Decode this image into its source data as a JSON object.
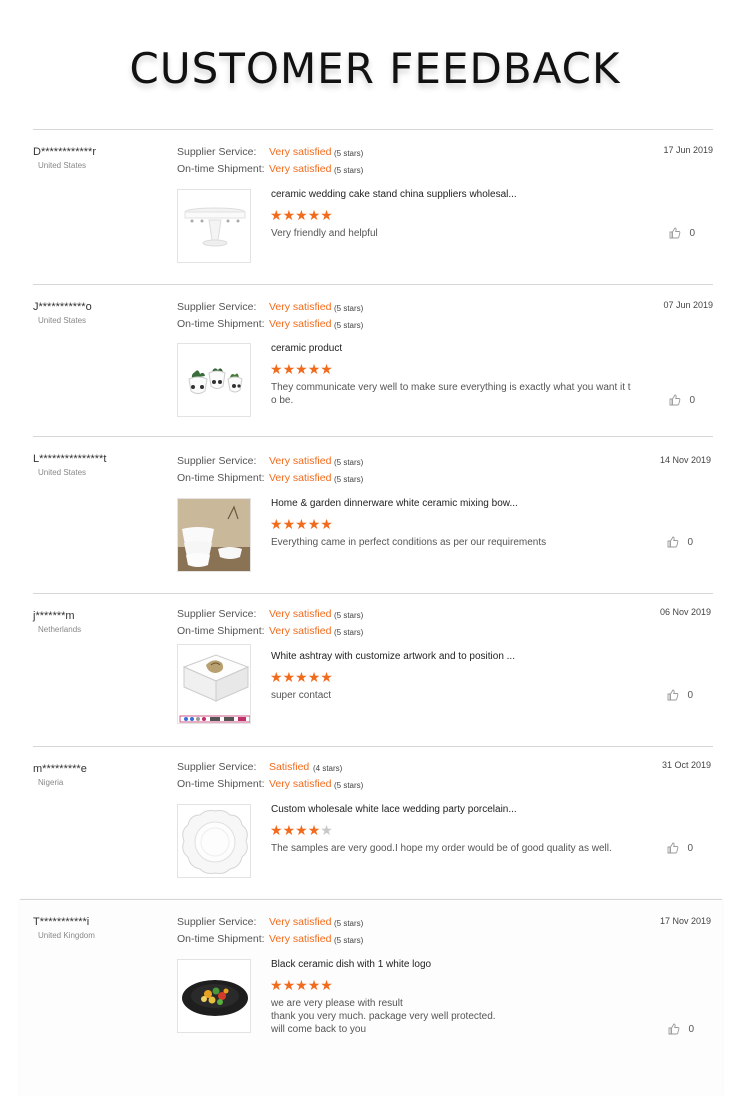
{
  "title": "CUSTOMER FEEDBACK",
  "labels": {
    "supplier_service": "Supplier Service:",
    "ontime_shipment": "On-time Shipment:"
  },
  "colors": {
    "accent": "#f26b1d",
    "star_off": "#c8c8c8"
  },
  "reviews": [
    {
      "user": "D************r",
      "country": "United States",
      "date": "17 Jun 2019",
      "supplier_value": "Very satisfied",
      "supplier_stars": "(5 stars)",
      "shipment_value": "Very satisfied",
      "shipment_stars": "(5 stars)",
      "product": "ceramic wedding cake stand china suppliers wholesal...",
      "rating": 5,
      "comment": "Very friendly and helpful",
      "likes": "0",
      "thumb_icon": "cake-stand-image"
    },
    {
      "user": "J***********o",
      "country": "United States",
      "date": "07 Jun 2019",
      "supplier_value": "Very satisfied",
      "supplier_stars": "(5 stars)",
      "shipment_value": "Very satisfied",
      "shipment_stars": "(5 stars)",
      "product": "ceramic product",
      "rating": 5,
      "comment": "They communicate very well to make sure everything is exactly what you want it t o be.",
      "likes": "0",
      "thumb_icon": "ceramic-pots-image"
    },
    {
      "user": "L***************t",
      "country": "United States",
      "date": "14 Nov 2019",
      "supplier_value": "Very satisfied",
      "supplier_stars": "(5 stars)",
      "shipment_value": "Very satisfied",
      "shipment_stars": "(5 stars)",
      "product": "Home & garden dinnerware white ceramic mixing bow...",
      "rating": 5,
      "comment": "Everything came in perfect conditions as per our requirements",
      "likes": "0",
      "thumb_icon": "mixing-bowls-image"
    },
    {
      "user": "j*******m",
      "country": "Netherlands",
      "date": "06 Nov 2019",
      "supplier_value": "Very satisfied",
      "supplier_stars": "(5 stars)",
      "shipment_value": "Very satisfied",
      "shipment_stars": "(5 stars)",
      "product": "White ashtray with customize artwork and to position ...",
      "rating": 5,
      "comment": "super contact",
      "likes": "0",
      "thumb_icon": "ashtray-image"
    },
    {
      "user": "m*********e",
      "country": "Nigeria",
      "date": "31 Oct 2019",
      "supplier_value": "Satisfied",
      "supplier_stars": "(4 stars)",
      "shipment_value": "Very satisfied",
      "shipment_stars": "(5 stars)",
      "product": "Custom wholesale white lace wedding party porcelain...",
      "rating": 4,
      "comment": "The samples are very good.I hope my order would be of good quality as well.",
      "likes": "0",
      "thumb_icon": "lace-plate-image"
    },
    {
      "user": "T***********i",
      "country": "United Kingdom",
      "date": "17 Nov 2019",
      "supplier_value": "Very satisfied",
      "supplier_stars": "(5 stars)",
      "shipment_value": "Very satisfied",
      "shipment_stars": "(5 stars)",
      "product": "Black ceramic dish with 1 white logo",
      "rating": 5,
      "comment_lines": [
        "we are very please with result",
        "thank you very much. package very well protected.",
        "will come back to you"
      ],
      "likes": "0",
      "thumb_icon": "black-dish-image"
    }
  ]
}
